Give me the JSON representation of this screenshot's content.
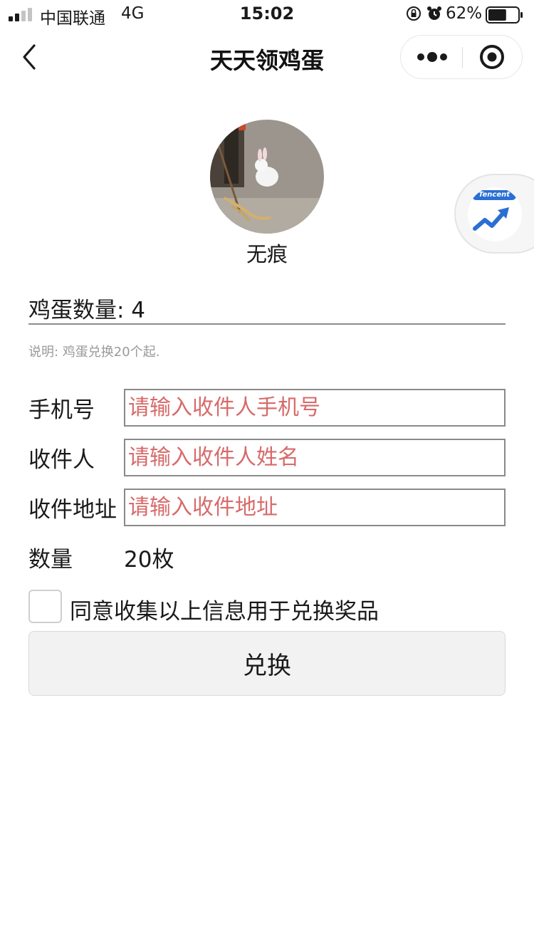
{
  "status_bar": {
    "carrier": "中国联通",
    "network": "4G",
    "time": "15:02",
    "battery_percent": "62%",
    "battery_level": 0.62,
    "signal_bars_active": 2,
    "signal_bars_total": 4
  },
  "nav": {
    "title": "天天领鸡蛋",
    "back_icon": "chevron-left-icon",
    "more_icon": "more-dots-icon",
    "close_icon": "target-circle-icon"
  },
  "floating_widget": {
    "brand": "Tencent",
    "icon": "trend-up-icon"
  },
  "profile": {
    "username": "无痕"
  },
  "egg_count": {
    "label": "鸡蛋数量: 4"
  },
  "note": "说明: 鸡蛋兑换20个起.",
  "form": {
    "phone_label": "手机号",
    "phone_placeholder": "请输入收件人手机号",
    "name_label": "收件人",
    "name_placeholder": "请输入收件人姓名",
    "address_label": "收件地址",
    "address_placeholder": "请输入收件地址",
    "quantity_label": "数量",
    "quantity_value": "20枚",
    "agree_text": "同意收集以上信息用于兑换奖品",
    "agree_checked": false,
    "submit_label": "兑换"
  },
  "colors": {
    "placeholder": "#d86a6a",
    "input_border": "#8a8a8a",
    "button_bg": "#f2f2f2",
    "accent_blue": "#2a6fd4"
  }
}
